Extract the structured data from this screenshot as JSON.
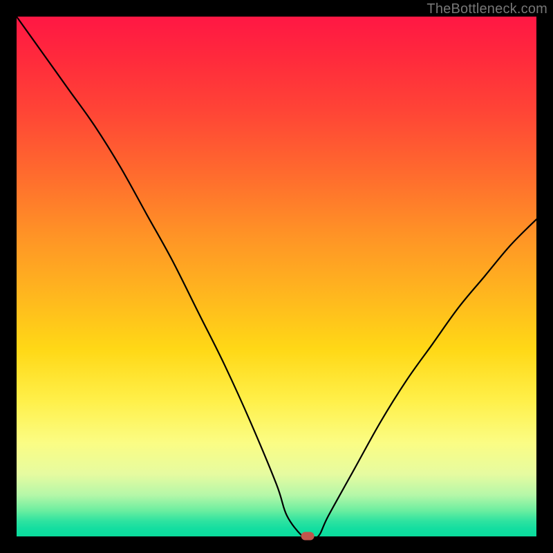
{
  "watermark": "TheBottleneck.com",
  "colors": {
    "frame": "#000000",
    "curve": "#000000",
    "marker": "#c0564d"
  },
  "chart_data": {
    "type": "line",
    "title": "",
    "xlabel": "",
    "ylabel": "",
    "xlim": [
      0,
      100
    ],
    "ylim": [
      0,
      100
    ],
    "grid": false,
    "legend": false,
    "background_gradient": {
      "top": "#ff1744",
      "middle": "#ffd816",
      "bottom": "#0adc9c"
    },
    "series": [
      {
        "name": "bottleneck-curve",
        "x": [
          0,
          5,
          10,
          15,
          20,
          25,
          30,
          35,
          40,
          45,
          50,
          52,
          55,
          56,
          58,
          60,
          65,
          70,
          75,
          80,
          85,
          90,
          95,
          100
        ],
        "values": [
          100,
          93,
          86,
          79,
          71,
          62,
          53,
          43,
          33,
          22,
          10,
          4,
          0,
          0,
          0,
          4,
          13,
          22,
          30,
          37,
          44,
          50,
          56,
          61
        ]
      }
    ],
    "marker": {
      "x": 56,
      "y": 0,
      "shape": "pill",
      "color": "#c0564d"
    }
  }
}
